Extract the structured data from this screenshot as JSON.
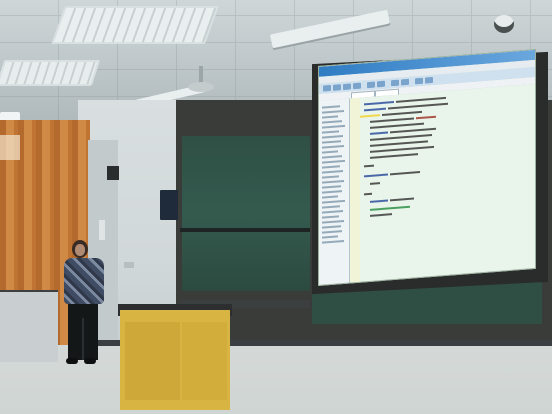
{
  "scene": {
    "description_label": "",
    "screen_window_title": "",
    "colors": {
      "ceiling": "#c6ced1",
      "wall": "#d5dcdd",
      "chalkboard": "#2f5045",
      "screen": "#d9ead6",
      "podium": "#d8b542",
      "curtain": "#c07434",
      "floor": "#d1d6d5"
    },
    "elements": [
      "ceiling-lights",
      "projection-screen",
      "chalkboard",
      "podium",
      "presenter",
      "security-camera"
    ]
  }
}
